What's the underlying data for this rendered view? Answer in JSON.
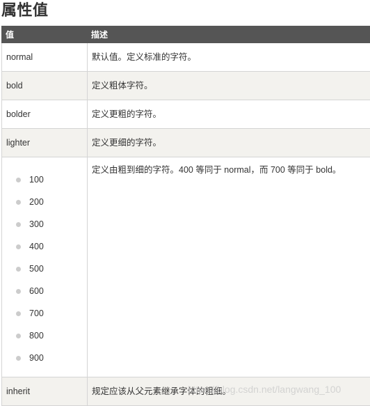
{
  "heading": "属性值",
  "table": {
    "headers": [
      "值",
      "描述"
    ],
    "rows": [
      {
        "value": "normal",
        "desc": "默认值。定义标准的字符。"
      },
      {
        "value": "bold",
        "desc": "定义粗体字符。"
      },
      {
        "value": "bolder",
        "desc": "定义更粗的字符。"
      },
      {
        "value": "lighter",
        "desc": "定义更细的字符。"
      },
      {
        "values": [
          "100",
          "200",
          "300",
          "400",
          "500",
          "600",
          "700",
          "800",
          "900"
        ],
        "desc": "定义由粗到细的字符。400 等同于 normal，而 700 等同于 bold。"
      },
      {
        "value": "inherit",
        "desc": "规定应该从父元素继承字体的粗细。"
      }
    ]
  },
  "watermark": "https://blog.csdn.net/langwang_100"
}
